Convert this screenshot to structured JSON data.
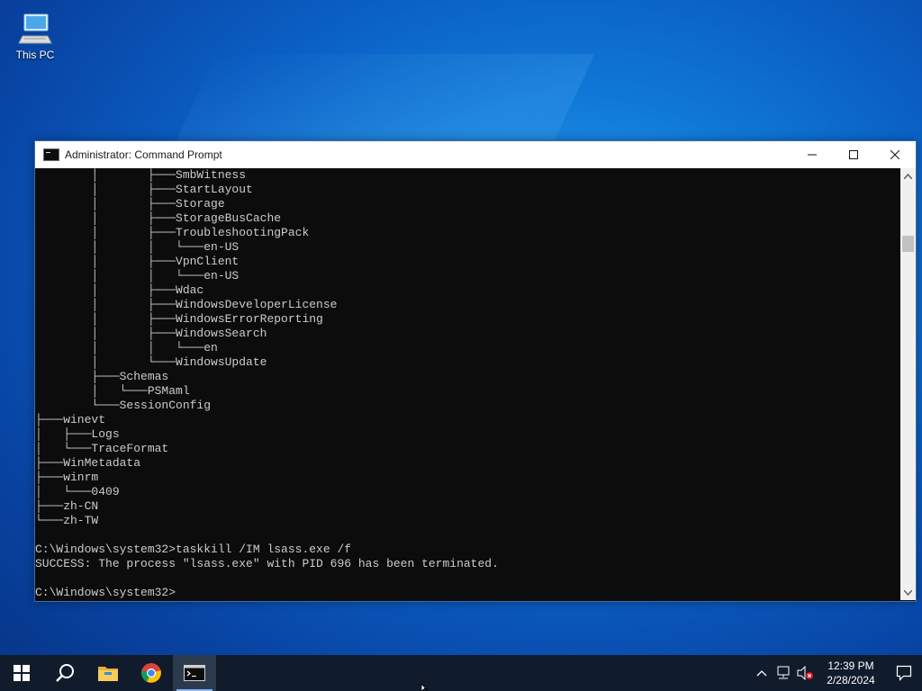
{
  "desktop": {
    "icon_label": "This PC"
  },
  "window": {
    "title": "Administrator: Command Prompt",
    "console_lines": [
      "        │       ├───SmbWitness",
      "        │       ├───StartLayout",
      "        │       ├───Storage",
      "        │       ├───StorageBusCache",
      "        │       ├───TroubleshootingPack",
      "        │       │   └───en-US",
      "        │       ├───VpnClient",
      "        │       │   └───en-US",
      "        │       ├───Wdac",
      "        │       ├───WindowsDeveloperLicense",
      "        │       ├───WindowsErrorReporting",
      "        │       ├───WindowsSearch",
      "        │       │   └───en",
      "        │       └───WindowsUpdate",
      "        ├───Schemas",
      "        │   └───PSMaml",
      "        └───SessionConfig",
      "├───winevt",
      "│   ├───Logs",
      "│   └───TraceFormat",
      "├───WinMetadata",
      "├───winrm",
      "│   └───0409",
      "├───zh-CN",
      "└───zh-TW",
      "",
      "C:\\Windows\\system32>taskkill /IM lsass.exe /f",
      "SUCCESS: The process \"lsass.exe\" with PID 696 has been terminated.",
      "",
      "C:\\Windows\\system32>"
    ]
  },
  "taskbar": {
    "items": [
      "start-icon",
      "search-icon",
      "file-explorer-icon",
      "chrome-icon",
      "command-prompt-icon"
    ],
    "clock_time": "12:39 PM",
    "clock_date": "2/28/2024"
  },
  "colors": {
    "console_bg": "#0c0c0c",
    "console_fg": "#cccccc",
    "taskbar_bg": "#101b2b",
    "accent": "#0f78d7"
  }
}
